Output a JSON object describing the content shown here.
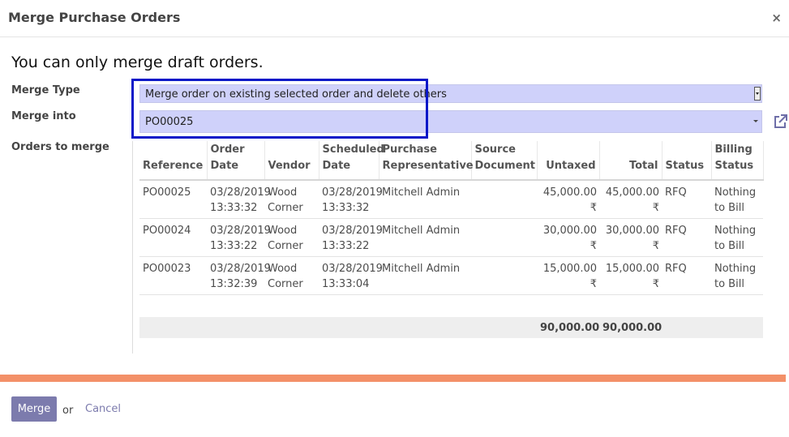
{
  "dialog": {
    "title": "Merge Purchase Orders",
    "close_glyph": "×"
  },
  "warning": "You can only merge draft orders.",
  "form": {
    "merge_type_label": "Merge Type",
    "merge_type_value": "Merge order on existing selected order and delete others",
    "merge_into_label": "Merge into",
    "merge_into_value": "PO00025",
    "orders_label": "Orders to merge"
  },
  "table": {
    "headers": {
      "reference": "Reference",
      "order_date_1": "Order",
      "order_date_2": "Date",
      "vendor": "Vendor",
      "scheduled_1": "Scheduled",
      "scheduled_2": "Date",
      "rep_1": "Purchase",
      "rep_2": "Representative",
      "source_1": "Source",
      "source_2": "Document",
      "untaxed": "Untaxed",
      "total": "Total",
      "status": "Status",
      "billing_1": "Billing",
      "billing_2": "Status"
    },
    "rows": [
      {
        "reference": "PO00025",
        "order_date": "03/28/2019",
        "order_time": "13:33:32",
        "vendor_1": "Wood",
        "vendor_2": "Corner",
        "scheduled_date": "03/28/2019",
        "scheduled_time": "13:33:32",
        "rep": "Mitchell Admin",
        "source": "",
        "untaxed": "45,000.00 ₹",
        "total": "45,000.00 ₹",
        "status": "RFQ",
        "billing_1": "Nothing",
        "billing_2": "to Bill"
      },
      {
        "reference": "PO00024",
        "order_date": "03/28/2019",
        "order_time": "13:33:22",
        "vendor_1": "Wood",
        "vendor_2": "Corner",
        "scheduled_date": "03/28/2019",
        "scheduled_time": "13:33:22",
        "rep": "Mitchell Admin",
        "source": "",
        "untaxed": "30,000.00 ₹",
        "total": "30,000.00 ₹",
        "status": "RFQ",
        "billing_1": "Nothing",
        "billing_2": "to Bill"
      },
      {
        "reference": "PO00023",
        "order_date": "03/28/2019",
        "order_time": "13:32:39",
        "vendor_1": "Wood",
        "vendor_2": "Corner",
        "scheduled_date": "03/28/2019",
        "scheduled_time": "13:33:04",
        "rep": "Mitchell Admin",
        "source": "",
        "untaxed": "15,000.00 ₹",
        "total": "15,000.00 ₹",
        "status": "RFQ",
        "billing_1": "Nothing",
        "billing_2": "to Bill"
      }
    ],
    "totals": {
      "untaxed": "90,000.00",
      "total": "90,000.00"
    }
  },
  "footer": {
    "merge_label": "Merge",
    "or_text": "or",
    "cancel_label": "Cancel"
  },
  "colors": {
    "field_bg": "#cfd1fa",
    "highlight_border": "#0a18c8",
    "accent_bar": "#f39068",
    "primary_button": "#7c7bad"
  },
  "icons": {
    "external_link": "external-link-icon",
    "close": "close-icon"
  }
}
